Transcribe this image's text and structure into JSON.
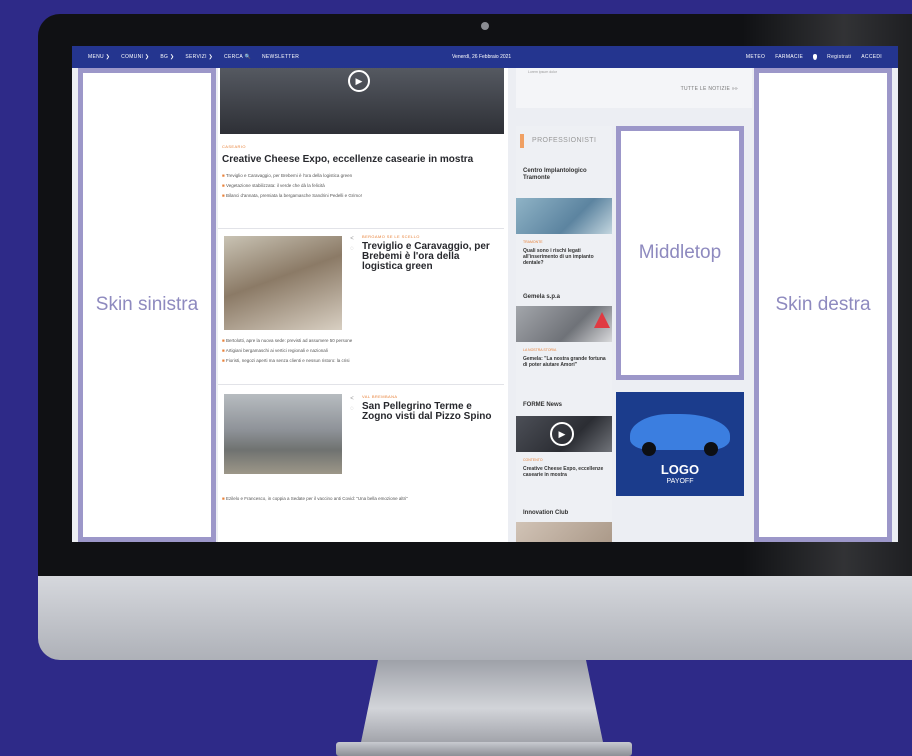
{
  "topbar": {
    "left_items": [
      "MENU ❯",
      "COMUNI ❯",
      "BG ❯",
      "SERVIZI ❯",
      "CERCA 🔍",
      "NEWSLETTER"
    ],
    "date": "Venerdì, 26 Febbraio 2021",
    "right_items": [
      "METEO",
      "FARMACIE",
      "Registrati",
      "ACCEDI"
    ]
  },
  "skins": {
    "left": "Skin sinistra",
    "right": "Skin destra"
  },
  "middletop": "Middletop",
  "articles": [
    {
      "category": "CASEARIO",
      "title": "Creative Cheese Expo, eccellenze casearie in mostra",
      "bullets": [
        "Treviglio e Caravaggio, per Brebemi è l'ora della logistica green",
        "Vegetazione stabilizzata: il verde che dà la felicità",
        "Bilanci d'annata, premiata la bergamasche Sandrini Pedelli e Grimo!"
      ]
    },
    {
      "category": "BERGAMO SE LE SCELLO",
      "title": "Treviglio e Caravaggio, per Brebemi è l'ora della logistica green",
      "bullets": [
        "Bertolotti, apre la nuova sede: previsti ad assumere 50 persone",
        "Artigiani bergamaschi ai vertici regionali e nazionali",
        "Fioristi, negozi aperti ma senza clienti e nessun ristoro: la crisi"
      ]
    },
    {
      "category": "VAL BREMBANA",
      "title": "San Pellegrino Terme e Zogno visti dal Pizzo Spino",
      "bullets": [
        "Ezilelo e Francesco, in coppia a Sedate per il vaccino anti Covid: \"Una bella emozione altri\""
      ]
    }
  ],
  "news_box": {
    "small_text": "Lorem ipsum dolor",
    "all_news": "TUTTE LE NOTIZIE »»"
  },
  "professionisti": {
    "heading": "PROFESSIONISTI",
    "entries": [
      {
        "name": "Centro Implantologico Tramonte",
        "category": "TRAMONTE",
        "text": "Quali sono i rischi legati all'inserimento di un impianto dentale?"
      },
      {
        "name": "Gemela s.p.a",
        "category": "LA NOSTRA STORIA",
        "text": "Gemela: \"La nostra grande fortuna di poter aiutare Amori\""
      },
      {
        "name": "FORME News",
        "category": "CONTENTO",
        "text": "Creative Cheese Expo, eccellenze casearie in mostra"
      },
      {
        "name": "Innovation Club",
        "category": "",
        "text": ""
      }
    ]
  },
  "ad": {
    "logo": "LOGO",
    "payoff": "PAYOFF",
    "brand_color": "#1b3c8c"
  },
  "colors": {
    "background": "#2e2a88",
    "topbar": "#24358f",
    "skin_border": "#9c97c9",
    "accent": "#e8823a"
  }
}
